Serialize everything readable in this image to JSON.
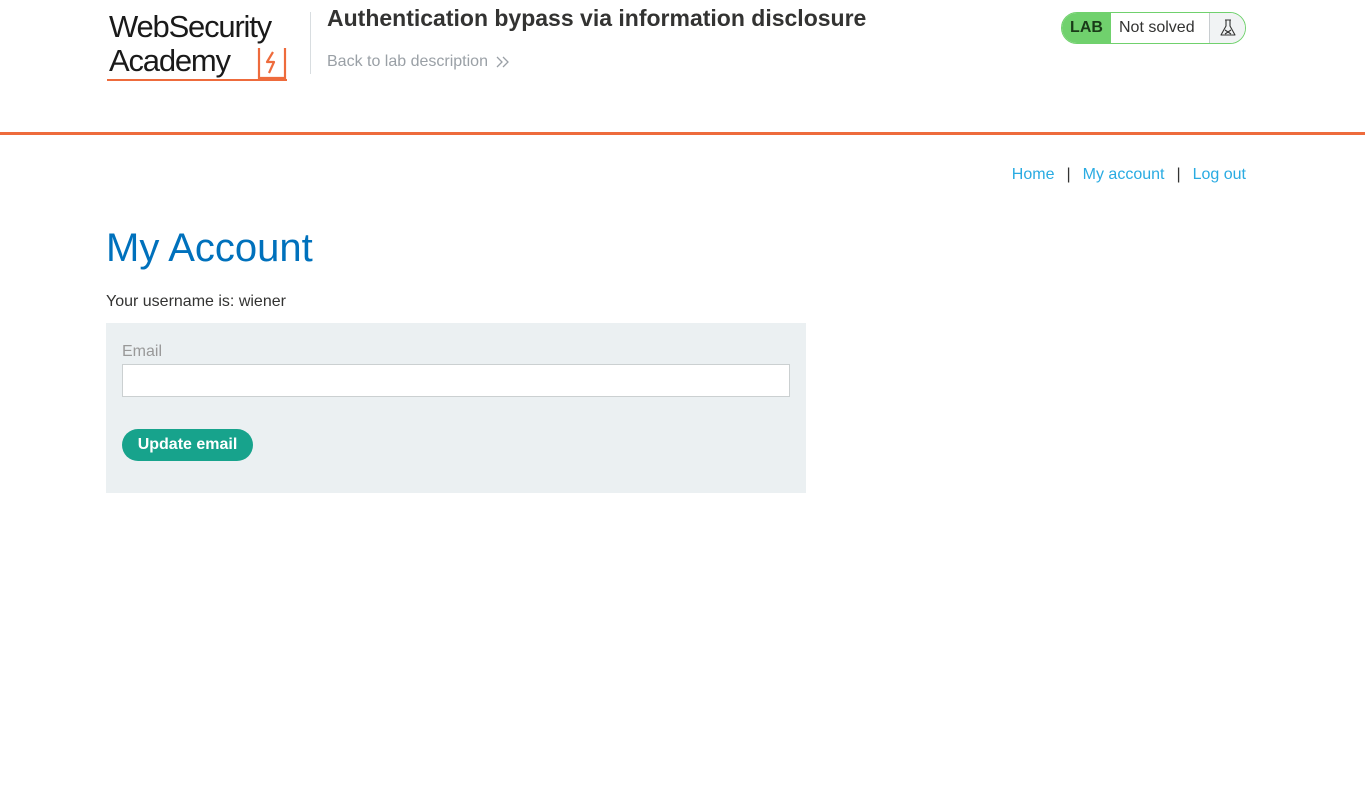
{
  "logo": {
    "line1": "WebSecurity",
    "line2": "Academy"
  },
  "lab": {
    "title": "Authentication bypass via information disclosure",
    "back_link": "Back to lab description",
    "badge": "LAB",
    "status": "Not solved",
    "status_icon": "flask-icon"
  },
  "nav": {
    "home": "Home",
    "separator": "|",
    "my_account": "My account",
    "log_out": "Log out"
  },
  "page": {
    "heading": "My Account",
    "username_line": "Your username is: wiener"
  },
  "form": {
    "email_label": "Email",
    "email_value": "",
    "submit_label": "Update email"
  },
  "colors": {
    "accent_orange": "#ee6b3c",
    "heading_blue": "#0071bc",
    "link_blue": "#29abe2",
    "lab_green": "#70d16d",
    "button_teal": "#17a38c",
    "panel_bg": "#ebf0f2"
  }
}
